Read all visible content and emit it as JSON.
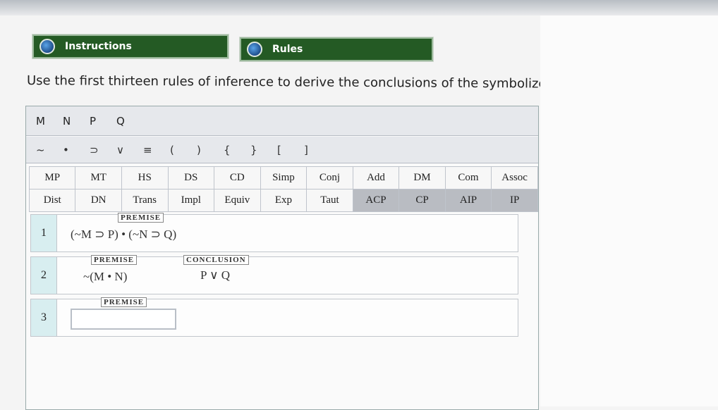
{
  "header": {
    "instructions_label": "Instructions",
    "rules_label": "Rules"
  },
  "prompt": "Use the first thirteen rules of inference to derive the conclusions of the symbolized argument below.",
  "variables": [
    "M",
    "N",
    "P",
    "Q"
  ],
  "operators": [
    "~",
    "•",
    "⊃",
    "∨",
    "≡",
    "(",
    ")",
    "{",
    "}",
    "[",
    "]"
  ],
  "rules_row1": [
    "MP",
    "MT",
    "HS",
    "DS",
    "CD",
    "Simp",
    "Conj",
    "Add",
    "DM",
    "Com",
    "Assoc"
  ],
  "rules_row2": [
    "Dist",
    "DN",
    "Trans",
    "Impl",
    "Equiv",
    "Exp",
    "Taut",
    "ACP",
    "CP",
    "AIP",
    "IP"
  ],
  "lines": [
    {
      "num": "1",
      "tag": "PREMISE",
      "expr": "(~M ⊃ P) • (~N ⊃ Q)"
    },
    {
      "num": "2",
      "tag": "PREMISE",
      "expr": "~(M • N)",
      "conclusion_tag": "CONCLUSION",
      "conclusion": "P ∨ Q"
    },
    {
      "num": "3",
      "tag": "PREMISE",
      "input_value": ""
    }
  ]
}
